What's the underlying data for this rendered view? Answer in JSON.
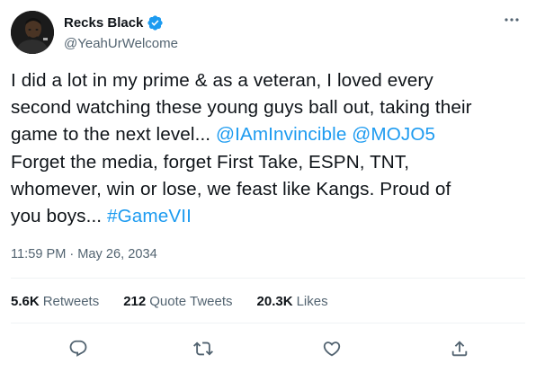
{
  "author": {
    "display_name": "Recks Black",
    "handle": "@YeahUrWelcome",
    "verified_icon": "verified-badge-icon",
    "avatar_icon": "profile-avatar",
    "more_icon": "more-options-icon"
  },
  "tweet": {
    "lines": [
      [
        {
          "text": "I did a lot in my prime & as a veteran, I loved every",
          "type": "text"
        }
      ],
      [
        {
          "text": "second watching these young guys ball out, taking their",
          "type": "text"
        }
      ],
      [
        {
          "text": "game to the next level... ",
          "type": "text"
        },
        {
          "text": "@IAmInvincible",
          "type": "mention"
        },
        {
          "text": " ",
          "type": "text"
        },
        {
          "text": "@MOJO5",
          "type": "mention"
        }
      ],
      [
        {
          "text": "Forget the media, forget First Take, ESPN, TNT,",
          "type": "text"
        }
      ],
      [
        {
          "text": "whomever, win or lose, we feast like Kangs. Proud of",
          "type": "text"
        }
      ],
      [
        {
          "text": "you boys... ",
          "type": "text"
        },
        {
          "text": "#GameVII",
          "type": "hashtag"
        }
      ]
    ],
    "time": "11:59 PM",
    "separator": "·",
    "date": "May 26, 2034"
  },
  "stats": {
    "retweets_count": "5.6K",
    "retweets_label": "Retweets",
    "quotes_count": "212",
    "quotes_label": "Quote Tweets",
    "likes_count": "20.3K",
    "likes_label": "Likes"
  },
  "actions": {
    "reply_icon": "reply-icon",
    "retweet_icon": "retweet-icon",
    "like_icon": "like-icon",
    "share_icon": "share-icon"
  },
  "colors": {
    "link": "#1d9bf0",
    "secondary_text": "#536471",
    "primary_text": "#0f1419",
    "verified": "#1d9bf0"
  }
}
